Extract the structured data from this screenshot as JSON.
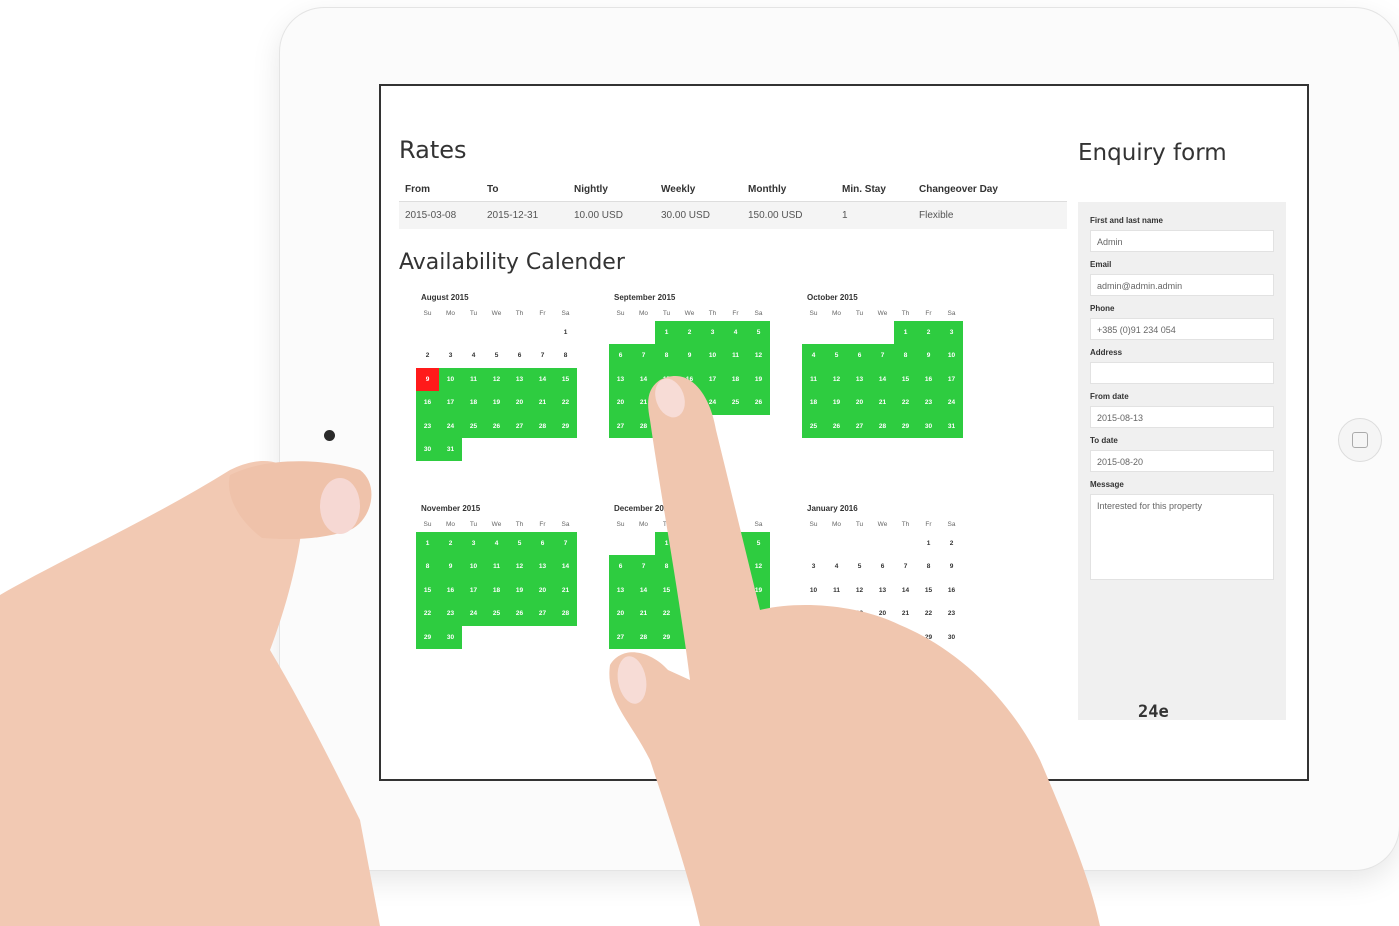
{
  "rates": {
    "title": "Rates",
    "headers": [
      "From",
      "To",
      "Nightly",
      "Weekly",
      "Monthly",
      "Min. Stay",
      "Changeover Day"
    ],
    "row": [
      "2015-03-08",
      "2015-12-31",
      "10.00 USD",
      "30.00 USD",
      "150.00 USD",
      "1",
      "Flexible"
    ]
  },
  "availability": {
    "title": "Availability Calender",
    "weekdays": [
      "Su",
      "Mo",
      "Tu",
      "We",
      "Th",
      "Fr",
      "Sa"
    ],
    "months": [
      {
        "name": "August 2015",
        "first_day": 6,
        "days": 31,
        "available_from": 9,
        "booked": [
          9
        ]
      },
      {
        "name": "September 2015",
        "first_day": 2,
        "days": 30,
        "available_from": 1,
        "booked": []
      },
      {
        "name": "October 2015",
        "first_day": 4,
        "days": 31,
        "available_from": 1,
        "booked": []
      },
      {
        "name": "November 2015",
        "first_day": 0,
        "days": 30,
        "available_from": 1,
        "booked": []
      },
      {
        "name": "December 2015",
        "first_day": 2,
        "days": 31,
        "available_from": 1,
        "available_to": 30,
        "booked": []
      },
      {
        "name": "January 2016",
        "first_day": 5,
        "days": 31,
        "available_from": 0,
        "booked": []
      }
    ],
    "colors": {
      "available": "#2ecc40",
      "booked": "#ff1a1a"
    }
  },
  "enquiry": {
    "title": "Enquiry form",
    "name_label": "First and last name",
    "name_value": "Admin",
    "email_label": "Email",
    "email_value": "admin@admin.admin",
    "phone_label": "Phone",
    "phone_value": "+385 (0)91 234 054",
    "address_label": "Address",
    "address_value": "",
    "from_label": "From date",
    "from_value": "2015-08-13",
    "to_label": "To date",
    "to_value": "2015-08-20",
    "message_label": "Message",
    "message_value": "Interested for this property",
    "captcha": "24e"
  }
}
